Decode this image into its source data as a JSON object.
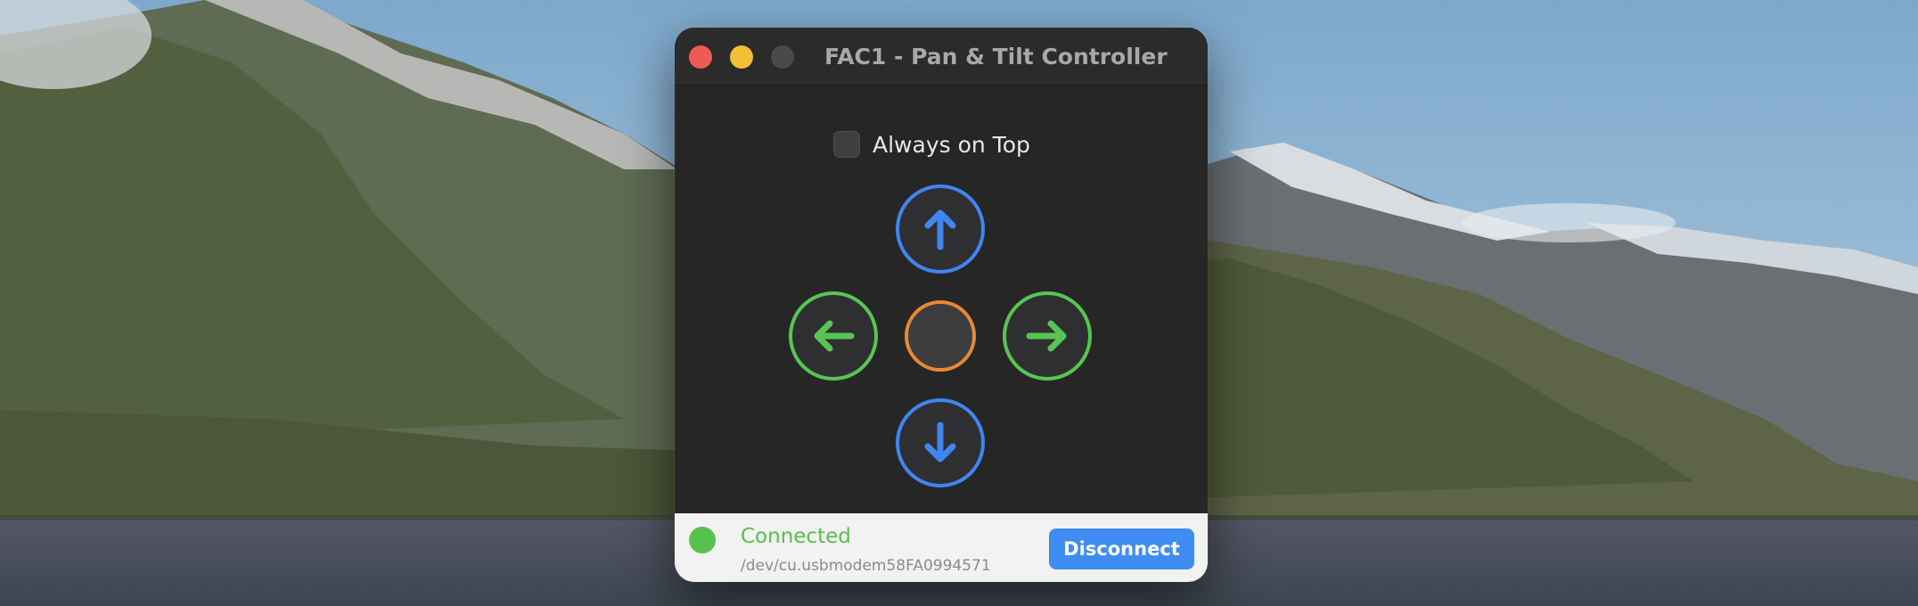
{
  "window": {
    "title": "FAC1 - Pan & Tilt Controller"
  },
  "options": {
    "always_on_top_label": "Always on Top",
    "always_on_top_checked": false
  },
  "controls": {
    "up_icon": "arrow-up-icon",
    "down_icon": "arrow-down-icon",
    "left_icon": "arrow-left-icon",
    "right_icon": "arrow-right-icon",
    "center_icon": "center-stop-icon"
  },
  "status": {
    "state": "Connected",
    "device": "/dev/cu.usbmodem58FA0994571",
    "button_label": "Disconnect"
  },
  "colors": {
    "tilt": "#3f86f0",
    "pan": "#58c552",
    "center": "#e68a35",
    "connected": "#57c14f",
    "button": "#3f8df2"
  }
}
